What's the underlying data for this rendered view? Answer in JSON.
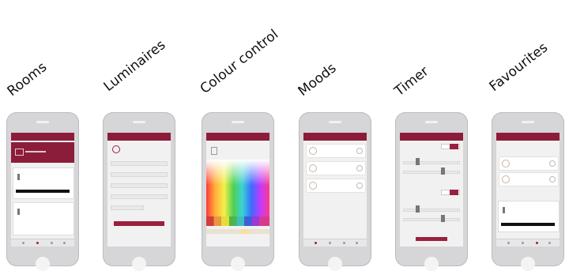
{
  "labels": [
    "Rooms",
    "Luminaires",
    "Colour control",
    "Moods",
    "Timer",
    "Favourites"
  ],
  "colors": {
    "accent": "#8c1d3a",
    "phone_body": "#d6d6d8",
    "screen_bg": "#f1f1f1"
  }
}
